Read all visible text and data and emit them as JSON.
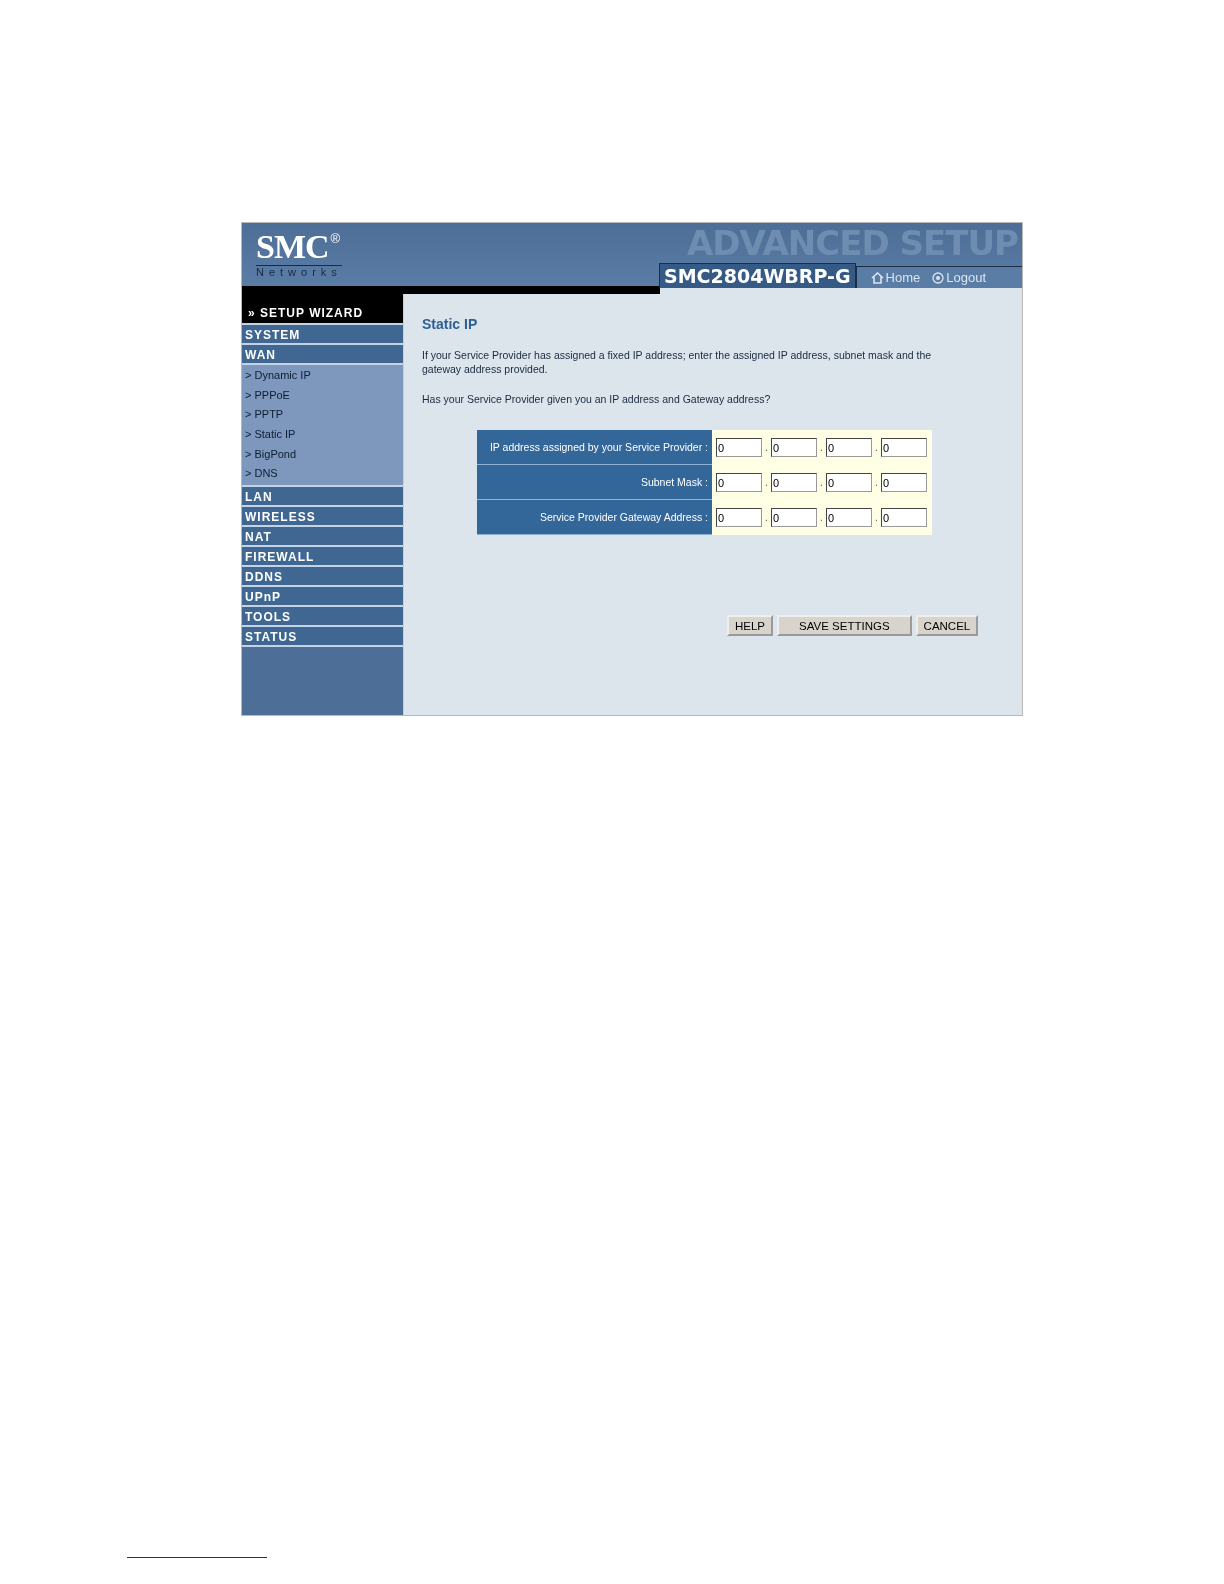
{
  "header": {
    "logo": "SMC",
    "logo_mark": "®",
    "logo_sub": "Networks",
    "banner": "ADVANCED SETUP",
    "model": "SMC2804WBRP-G",
    "links": [
      {
        "label": "Home",
        "kind": "home"
      },
      {
        "label": "Logout",
        "kind": "logout"
      }
    ]
  },
  "sidebar": {
    "wizard": "» SETUP WIZARD",
    "items": [
      {
        "label": "SYSTEM"
      },
      {
        "label": "WAN",
        "children": [
          "> Dynamic IP",
          "> PPPoE",
          "> PPTP",
          "> Static IP",
          "> BigPond",
          "> DNS"
        ]
      },
      {
        "label": "LAN"
      },
      {
        "label": "WIRELESS"
      },
      {
        "label": "NAT"
      },
      {
        "label": "FIREWALL"
      },
      {
        "label": "DDNS"
      },
      {
        "label": "UPnP"
      },
      {
        "label": "TOOLS"
      },
      {
        "label": "STATUS"
      }
    ]
  },
  "content": {
    "title": "Static IP",
    "intro": "If your Service Provider has assigned a fixed IP address; enter the assigned IP address, subnet mask and the gateway address provided.",
    "question": "Has your Service Provider given you an IP address and Gateway address?",
    "rows": [
      {
        "label": "IP address assigned by your Service Provider :",
        "octets": [
          "0",
          "0",
          "0",
          "0"
        ],
        "separators": [
          ".",
          ".",
          "."
        ]
      },
      {
        "label": "Subnet Mask :",
        "octets": [
          "0",
          "0",
          "0",
          "0"
        ],
        "separators": [
          ".",
          ".",
          "."
        ]
      },
      {
        "label": "Service Provider Gateway Address :",
        "octets": [
          "0",
          "0",
          "0",
          "0"
        ],
        "separators": [
          ".",
          ".",
          "."
        ]
      }
    ],
    "buttons": [
      "HELP",
      "SAVE SETTINGS",
      "CANCEL"
    ]
  }
}
